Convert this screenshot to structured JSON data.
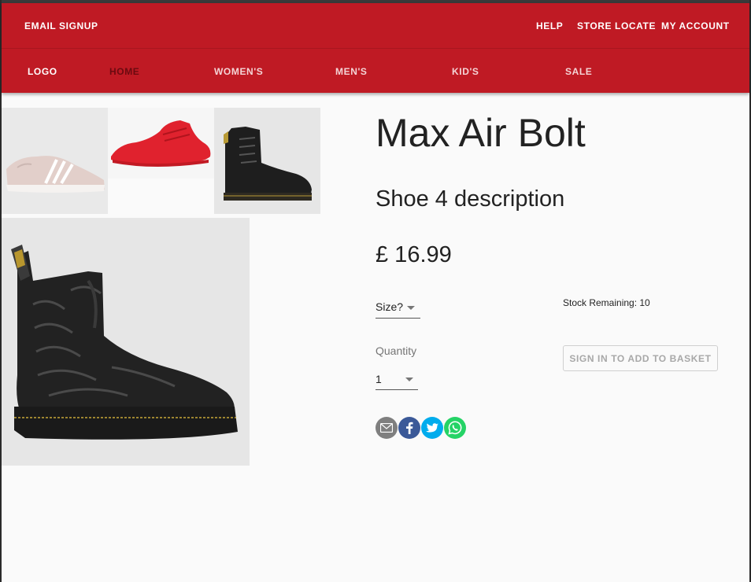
{
  "header": {
    "top_left": "EMAIL SIGNUP",
    "top_right": [
      "HELP",
      "STORE LOCATE",
      "MY ACCOUNT"
    ],
    "nav": {
      "logo": "LOGO",
      "items": [
        "HOME",
        "WOMEN'S",
        "MEN'S",
        "KID'S",
        "SALE"
      ],
      "active": "HOME"
    }
  },
  "product": {
    "title": "Max Air Bolt",
    "description": "Shoe 4 description",
    "price": "£ 16.99",
    "size_label": "Size?",
    "quantity_label": "Quantity",
    "quantity_value": "1",
    "stock_text": "Stock Remaining: 10",
    "basket_button": "SIGN IN TO ADD TO BASKET"
  },
  "gallery": {
    "thumbnails": [
      "pink-sneaker-image",
      "red-high-top-sneaker-image",
      "black-combat-boot-image"
    ],
    "main": "black-platform-boot-image"
  },
  "share_icons": [
    {
      "name": "email-icon",
      "color": "#7f7f7f"
    },
    {
      "name": "facebook-icon",
      "color": "#3b5998"
    },
    {
      "name": "twitter-icon",
      "color": "#00aced"
    },
    {
      "name": "whatsapp-icon",
      "color": "#25d366"
    }
  ],
  "colors": {
    "brand": "#bf1a24",
    "background": "#fafafa"
  }
}
